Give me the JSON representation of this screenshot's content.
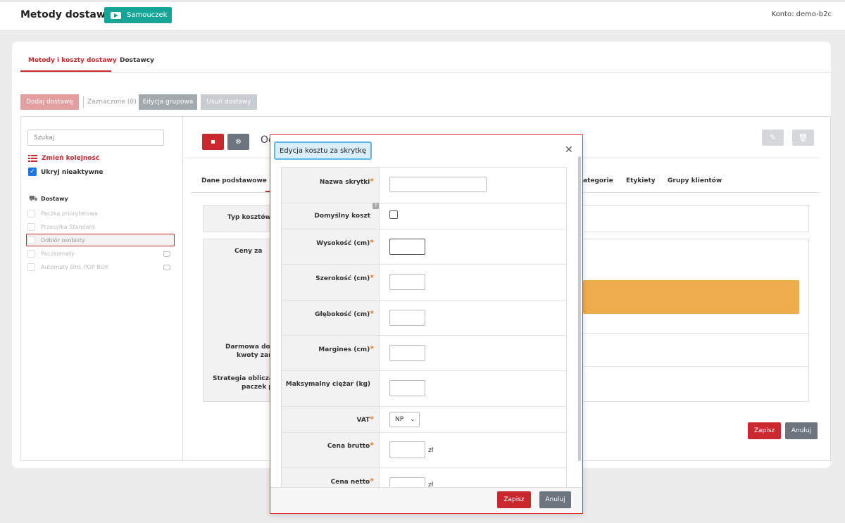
{
  "header": {
    "title": "Metody dostawy",
    "tutorial_label": "Samouczek",
    "account": "Konto: demo-b2c"
  },
  "tabs": [
    {
      "label": "Metody i koszty dostawy",
      "active": true
    },
    {
      "label": "Dostawcy",
      "active": false
    }
  ],
  "toolbar": {
    "add": "Dodaj dostawę",
    "selected": "Zaznaczone (0)",
    "group_edit": "Edycja grupowa",
    "delete": "Usuń dostawy"
  },
  "sidebar": {
    "search_placeholder": "Szukaj",
    "reorder": "Zmień kolejność",
    "hide_inactive": "Ukryj nieaktywne",
    "section": "Dostawy",
    "items": [
      {
        "label": "Paczka priorytetowa",
        "selected": false,
        "monitor": false
      },
      {
        "label": "Przesyłka Standard",
        "selected": false,
        "monitor": false
      },
      {
        "label": "Odbiór osobisty",
        "selected": true,
        "monitor": false
      },
      {
        "label": "Paczkomaty",
        "selected": false,
        "monitor": true
      },
      {
        "label": "Automaty DHL POP BOX",
        "selected": false,
        "monitor": true
      }
    ]
  },
  "detail": {
    "title_fragment": "Od",
    "inner_tabs": [
      "Dane podstawowe",
      "ategorie",
      "Etykiety",
      "Grupy klientów"
    ],
    "labels": {
      "cost_type": "Typ kosztów d",
      "prices": "Ceny za",
      "free_1": "Darmowa dost",
      "free_2": "kwoty zam",
      "strategy_1": "Strategia obliczani",
      "strategy_2": "paczek p"
    },
    "save": "Zapisz",
    "cancel": "Anuluj"
  },
  "modal": {
    "title": "Edycja kosztu za skrytkę",
    "help": "?",
    "fields": {
      "name": "Nazwa skrytki",
      "default": "Domyślny koszt",
      "height": "Wysokość (cm)",
      "width": "Szerokość (cm)",
      "depth": "Głębokość (cm)",
      "margin": "Margines (cm)",
      "max_weight": "Maksymalny ciężar (kg)",
      "vat": "VAT",
      "gross": "Cena brutto",
      "net": "Cena netto"
    },
    "vat_value": "NP",
    "currency": "zł",
    "required_mark": "*",
    "save": "Zapisz",
    "cancel": "Anuluj"
  },
  "colors": {
    "accent": "#c8282e",
    "teal": "#16a597",
    "orange": "#efac4d",
    "gray_button": "#6c757d"
  }
}
